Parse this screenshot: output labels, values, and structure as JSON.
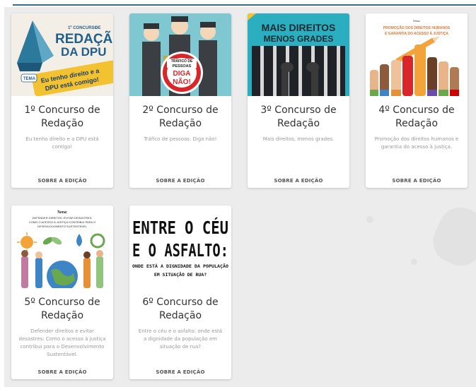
{
  "cards": [
    {
      "title": "1º Concurso de Redação",
      "description": "Eu tenho direito e a DPU está comigo!",
      "link_label": "SOBRE A EDIÇÃO",
      "image_text": {
        "heading_small": "1º CONCURSO",
        "heading_small_2": "DE",
        "heading_big": "REDAÇÃO",
        "heading_big_2": "DA DPU",
        "tag": "TEMA",
        "slogan": "Eu tenho direito e a",
        "slogan_2": "DPU está comigo!"
      }
    },
    {
      "title": "2º Concurso de Redação",
      "description": "Tráfico de pessoas. Diga não!",
      "link_label": "SOBRE A EDIÇÃO",
      "image_text": {
        "sign_1": "TRÁFICO DE",
        "sign_2": "PESSOAS",
        "sign_3": "DIGA",
        "sign_4": "NÃO!"
      }
    },
    {
      "title": "3º Concurso de Redação",
      "description": "Mais direitos, menos grades.",
      "link_label": "SOBRE A EDIÇÃO",
      "image_text": {
        "line_1": "MAIS DIREITOS",
        "line_2": "MENOS GRADES"
      }
    },
    {
      "title": "4º Concurso de Redação",
      "description": "Promoção dos direitos humanos e garantia do acesso à justiça.",
      "link_label": "SOBRE A EDIÇÃO",
      "image_text": {
        "tag": "Tema:",
        "line_1": "PROMOÇÃO DOS DIREITOS HUMANOS",
        "line_2": "E GARANTIA DO ACESSO À JUSTIÇA"
      }
    },
    {
      "title": "5º Concurso de Redação",
      "description": "Defender direitos e evitar desastres: Como o acesso à justiça contribui para o Desenvolvimento Sustentável.",
      "link_label": "SOBRE A EDIÇÃO",
      "image_text": {
        "tag": "Tema:",
        "line_1": "DEFENDER DIREITOS, EVITAR DESASTRES:",
        "line_2": "COMO O ACESSO À JUSTIÇA CONTRIBUI PARA O",
        "line_3": "DESENVOLVIMENTO SUSTENTÁVEL"
      }
    },
    {
      "title": "6º Concurso de Redação",
      "description": "Entre o céu e o asfalto: onde está a dignidade da população em situação de rua?",
      "link_label": "SOBRE A EDIÇÃO",
      "image_text": {
        "line_1": "ENTRE O CÉU",
        "line_2": "E O ASFALTO:",
        "line_3": "ONDE ESTÁ A DIGNIDADE DA POPULAÇÃO",
        "line_4": "EM SITUAÇÃO DE RUA?"
      }
    }
  ]
}
